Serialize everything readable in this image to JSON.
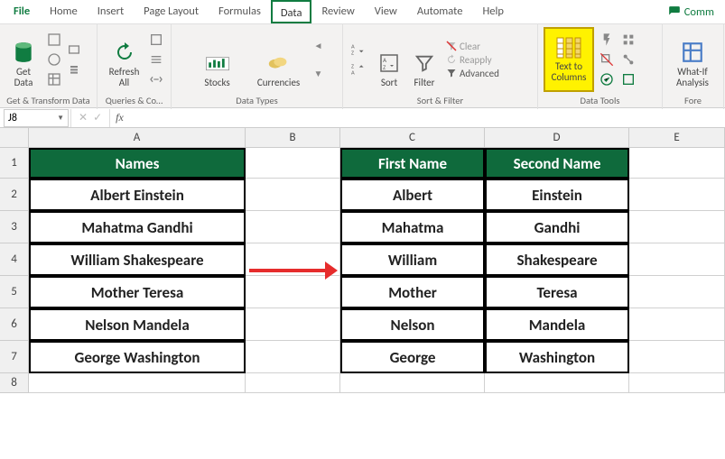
{
  "menu": {
    "file": "File",
    "home": "Home",
    "insert": "Insert",
    "page_layout": "Page Layout",
    "formulas": "Formulas",
    "data": "Data",
    "review": "Review",
    "view": "View",
    "automate": "Automate",
    "help": "Help",
    "comments": "Comm"
  },
  "ribbon": {
    "get_data": "Get\nData",
    "get_transform": "Get & Transform Data",
    "refresh_all": "Refresh\nAll",
    "queries": "Queries & Co…",
    "stocks": "Stocks",
    "currencies": "Currencies",
    "data_types": "Data Types",
    "sort": "Sort",
    "filter": "Filter",
    "clear": "Clear",
    "reapply": "Reapply",
    "advanced": "Advanced",
    "sort_filter": "Sort & Filter",
    "text_to_columns": "Text to\nColumns",
    "data_tools": "Data Tools",
    "what_if": "What-If\nAnalysis",
    "fore": "Fore"
  },
  "namebox": "J8",
  "fx": "fx",
  "columns": {
    "A": "A",
    "B": "B",
    "C": "C",
    "D": "D",
    "E": "E"
  },
  "rows": [
    "1",
    "2",
    "3",
    "4",
    "5",
    "6",
    "7",
    "8"
  ],
  "headers": {
    "names": "Names",
    "first": "First Name",
    "second": "Second Name"
  },
  "data": {
    "full": [
      "Albert Einstein",
      "Mahatma Gandhi",
      "William Shakespeare",
      "Mother Teresa",
      "Nelson Mandela",
      "George Washington"
    ],
    "first": [
      "Albert",
      "Mahatma",
      "William",
      "Mother",
      "Nelson",
      "George"
    ],
    "second": [
      "Einstein",
      "Gandhi",
      "Shakespeare",
      "Teresa",
      "Mandela",
      "Washington"
    ]
  }
}
